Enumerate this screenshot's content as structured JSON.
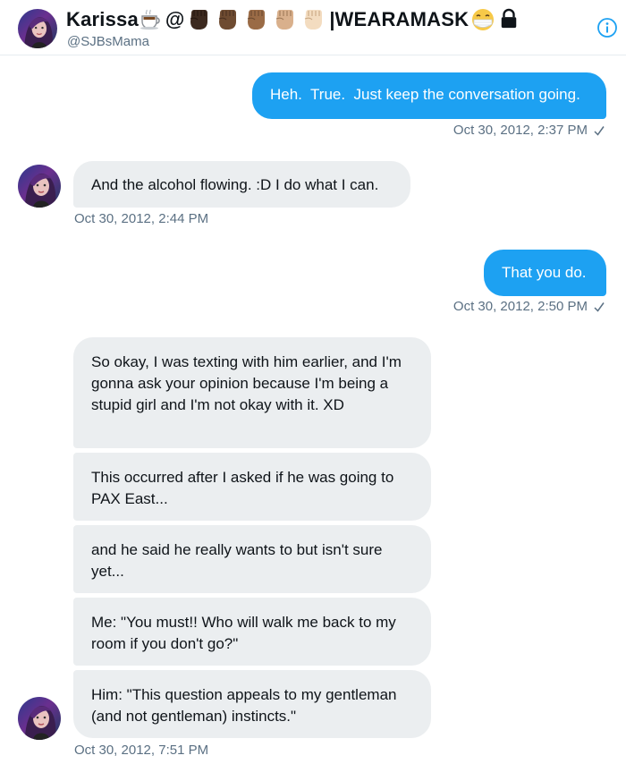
{
  "header": {
    "display_name": "Karissa",
    "at_sign": "@",
    "separator": "|",
    "tag": "WEARAMASK",
    "handle": "@SJBsMama",
    "icons": [
      "hot-beverage-icon",
      "raised-fist-dark-icon",
      "raised-fist-medium-dark-icon",
      "raised-fist-medium-icon",
      "raised-fist-medium-light-icon",
      "raised-fist-light-icon",
      "face-with-medical-mask-icon",
      "lock-icon"
    ],
    "info_icon": "info-icon"
  },
  "colors": {
    "accent": "#1da1f2",
    "incoming_bubble": "#ebeef0",
    "timestamp": "#5b7083"
  },
  "messages": [
    {
      "direction": "out",
      "text": "Heh.  True.  Just keep the conversation going.",
      "timestamp": "Oct 30, 2012, 2:37 PM"
    },
    {
      "direction": "in",
      "text": "And the alcohol flowing. :D I do what I can.",
      "timestamp": "Oct 30, 2012, 2:44 PM"
    },
    {
      "direction": "out",
      "text": "That you do.",
      "timestamp": "Oct 30, 2012, 2:50 PM"
    },
    {
      "direction": "in",
      "text": "So okay, I was texting with him earlier, and I'm gonna ask your opinion because I'm being a stupid girl and I'm not okay with it. XD"
    },
    {
      "direction": "in",
      "text": "This occurred after I asked if he was going to PAX East..."
    },
    {
      "direction": "in",
      "text": "and he said he really wants to but isn't sure yet..."
    },
    {
      "direction": "in",
      "text": "Me: \"You must!! Who will walk me back to my room if you don't go?\""
    },
    {
      "direction": "in",
      "text": "Him: \"This question appeals to my gentleman (and not gentleman) instincts.\"",
      "timestamp": "Oct 30, 2012, 7:51 PM"
    }
  ]
}
